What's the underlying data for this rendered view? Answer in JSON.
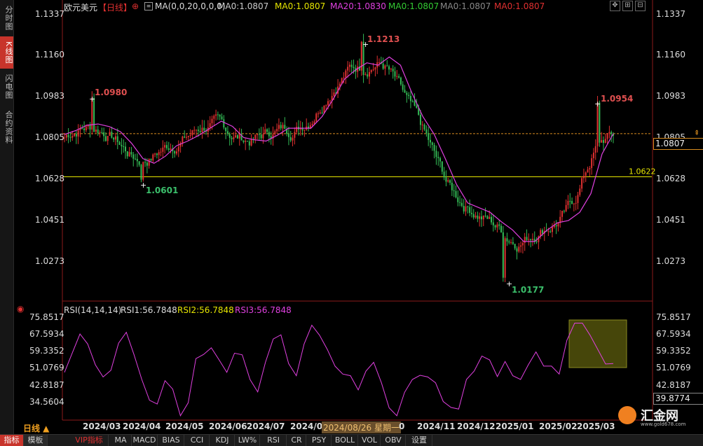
{
  "sidebar": {
    "tabs": [
      "分时图",
      "K线图",
      "闪电图",
      "合约资料"
    ],
    "active_index": 1
  },
  "header": {
    "symbol": "欧元美元",
    "period": "【日线】",
    "ma_label": "MA(0,0,20,0,0,0)",
    "ma_values": [
      {
        "text": "MA0:1.0807",
        "color": "#cccccc"
      },
      {
        "text": "MA0:1.0807",
        "color": "#e6e600"
      },
      {
        "text": "MA20:1.0830",
        "color": "#e040e0"
      },
      {
        "text": "MA0:1.0807",
        "color": "#33cc33"
      },
      {
        "text": "MA0:1.0807",
        "color": "#888888"
      },
      {
        "text": "MA0:1.0807",
        "color": "#e03030"
      }
    ]
  },
  "rsi_header": {
    "label": "RSI(14,14,14)",
    "rsi1": "RSI1:56.7848",
    "rsi2": "RSI2:56.7848",
    "rsi3": "RSI3:56.7848"
  },
  "price_axis": [
    "1.1337",
    "1.1160",
    "1.0983",
    "1.0805",
    "1.0628",
    "1.0451",
    "1.0273"
  ],
  "rsi_axis": [
    "75.8517",
    "67.5934",
    "59.3352",
    "51.0769",
    "42.8187",
    "34.5604"
  ],
  "current_price": "1.0807",
  "current_rsi": "39.8774",
  "support_level": "1.0622",
  "right_axis_partial": "1.0805",
  "annotations": {
    "high1": "1.0980",
    "low1": "1.0601",
    "high2": "1.1213",
    "low2": "1.0177",
    "high3": "1.0954"
  },
  "date_axis": [
    "2024/03",
    "2024/04",
    "2024/05",
    "2024/06",
    "2024/07",
    "2024/08",
    "2024/11",
    "2024/12",
    "2025/01",
    "2025/02",
    "2025/03"
  ],
  "crosshair_date": "2024/08/26 星期一",
  "crosshair_extra": "0",
  "period_label": "日线 ▲",
  "toolbar": [
    "指标",
    "模板",
    "VIP指标",
    "MA",
    "MACD",
    "BIAS",
    "CCI",
    "KDJ",
    "LW%",
    "RSI",
    "CR",
    "PSY",
    "BOLL",
    "VOL",
    "OBV",
    "设置"
  ],
  "watermark": {
    "brand": "汇金网",
    "url": "www.gold678.com"
  },
  "colors": {
    "up": "#e03030",
    "down": "#33bb55",
    "ma20": "#e040e0",
    "support": "#e6e600",
    "rsi": "#e040e0",
    "highlight": "#6b6b10"
  },
  "chart_data": {
    "type": "candlestick",
    "series_ma20": [
      1.0803,
      1.082,
      1.0843,
      1.0848,
      1.0837,
      1.0815,
      1.0765,
      1.07,
      1.068,
      1.071,
      1.0755,
      1.0775,
      1.08,
      1.083,
      1.086,
      1.0838,
      1.079,
      1.078,
      1.0775,
      1.08,
      1.083,
      1.083,
      1.083,
      1.088,
      1.0955,
      1.104,
      1.108,
      1.111,
      1.11,
      1.1135,
      1.11,
      1.0983,
      1.088,
      1.0805,
      1.07,
      1.059,
      1.051,
      1.049,
      1.047,
      1.043,
      1.0395,
      1.0345,
      1.0345,
      1.039,
      1.0425,
      1.0435,
      1.047,
      1.055,
      1.072,
      1.0807
    ],
    "rsi": [
      52,
      60,
      68,
      62,
      55,
      48,
      50,
      66,
      70,
      58,
      45,
      38,
      35,
      45,
      44,
      30,
      35,
      55,
      60,
      62,
      55,
      52,
      60,
      58,
      45,
      42,
      55,
      65,
      70,
      55,
      48,
      62,
      74,
      68,
      60,
      55,
      50,
      48,
      40,
      52,
      55,
      44,
      35,
      30,
      40,
      45,
      50,
      48,
      44,
      38,
      34,
      32,
      45,
      52,
      58,
      55,
      50,
      56,
      48,
      45,
      55,
      60,
      52,
      55,
      50,
      65,
      72,
      75,
      68,
      60,
      56,
      55
    ],
    "rsi_range": [
      34.5604,
      75.8517
    ],
    "price_range": [
      1.0177,
      1.1337
    ]
  }
}
